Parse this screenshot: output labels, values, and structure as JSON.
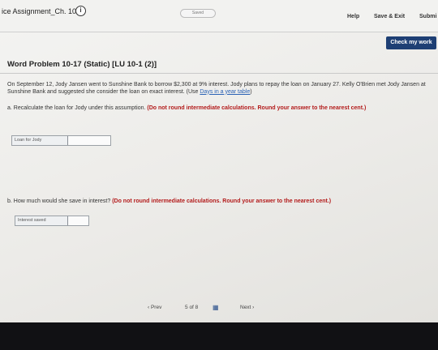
{
  "header": {
    "assignment_title": "ice Assignment_Ch. 10",
    "info_icon": "info-icon",
    "saved_label": "Saved",
    "help_label": "Help",
    "save_exit_label": "Save & Exit",
    "submit_label": "Submi"
  },
  "toolbar": {
    "check_label": "Check my work"
  },
  "problem": {
    "title": "Word Problem 10-17 (Static) [LU 10-1 (2)]",
    "text": "On September 12, Jody Jansen went to Sunshine Bank to borrow $2,300 at 9% interest. Jody plans to repay the loan on January 27. Kelly O'Brien met Jody Jansen at Sunshine Bank and suggested she consider the loan on exact interest. (Use ",
    "link": "Days in a year table",
    "text_end": ")"
  },
  "question_a": {
    "text": "a. Recalculate the loan for Jody under this assumption. ",
    "instruction": "(Do not round intermediate calculations. Round your answer to the nearest cent.)",
    "field_label": "Loan for Jody",
    "field_value": ""
  },
  "question_b": {
    "text": "b. How much would she save in interest? ",
    "instruction": "(Do not round intermediate calculations. Round your answer to the nearest cent.)",
    "field_label": "Interest saved",
    "field_value": ""
  },
  "pager": {
    "prev_label": "‹ Prev",
    "current": "5",
    "of_label": "of",
    "total": "8",
    "grid_icon": "grid-icon",
    "next_label": "Next ›"
  }
}
